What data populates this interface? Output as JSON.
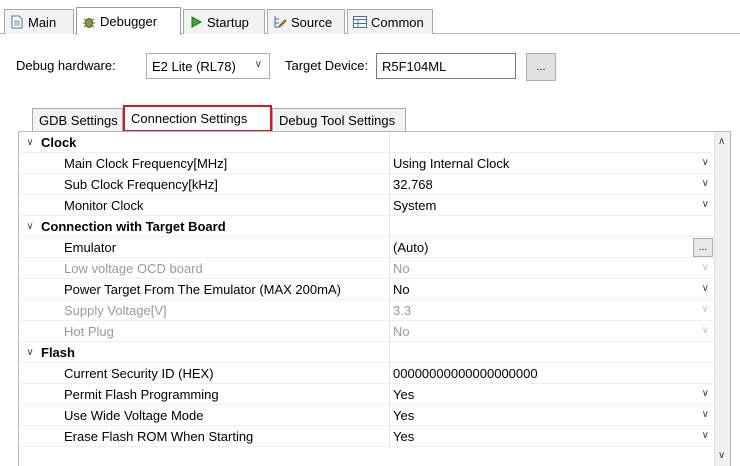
{
  "top_tabs": [
    {
      "label": "Main",
      "icon": "document-icon"
    },
    {
      "label": "Debugger",
      "icon": "bug-icon"
    },
    {
      "label": "Startup",
      "icon": "play-icon"
    },
    {
      "label": "Source",
      "icon": "source-lookup-icon"
    },
    {
      "label": "Common",
      "icon": "table-icon"
    }
  ],
  "debug_hardware": {
    "label": "Debug hardware:",
    "value": "E2 Lite (RL78)",
    "target_label": "Target Device:",
    "target_value": "R5F104ML",
    "browse_label": "..."
  },
  "inner_tabs": [
    "GDB Settings",
    "Connection Settings",
    "Debug Tool Settings"
  ],
  "grid": {
    "categories": [
      {
        "name": "Clock",
        "rows": [
          {
            "name": "Main Clock Frequency[MHz]",
            "value": "Using Internal Clock"
          },
          {
            "name": "Sub Clock Frequency[kHz]",
            "value": "32.768"
          },
          {
            "name": "Monitor Clock",
            "value": "System"
          }
        ]
      },
      {
        "name": "Connection with Target Board",
        "rows": [
          {
            "name": "Emulator",
            "value": "(Auto)",
            "button": "..."
          },
          {
            "name": "Low voltage OCD board",
            "value": "No"
          },
          {
            "name": "Power Target From The Emulator (MAX 200mA)",
            "value": "No"
          },
          {
            "name": "Supply Voltage[V]",
            "value": "3.3"
          },
          {
            "name": "Hot Plug",
            "value": "No"
          }
        ]
      },
      {
        "name": "Flash",
        "rows": [
          {
            "name": "Current Security ID (HEX)",
            "value": "00000000000000000000"
          },
          {
            "name": "Permit Flash Programming",
            "value": "Yes"
          },
          {
            "name": "Use Wide Voltage Mode",
            "value": "Yes"
          },
          {
            "name": "Erase Flash ROM When Starting",
            "value": "Yes"
          }
        ]
      }
    ]
  },
  "colors": {
    "highlight_border": "#d9171f",
    "disabled_text": "#9a9a9a"
  }
}
